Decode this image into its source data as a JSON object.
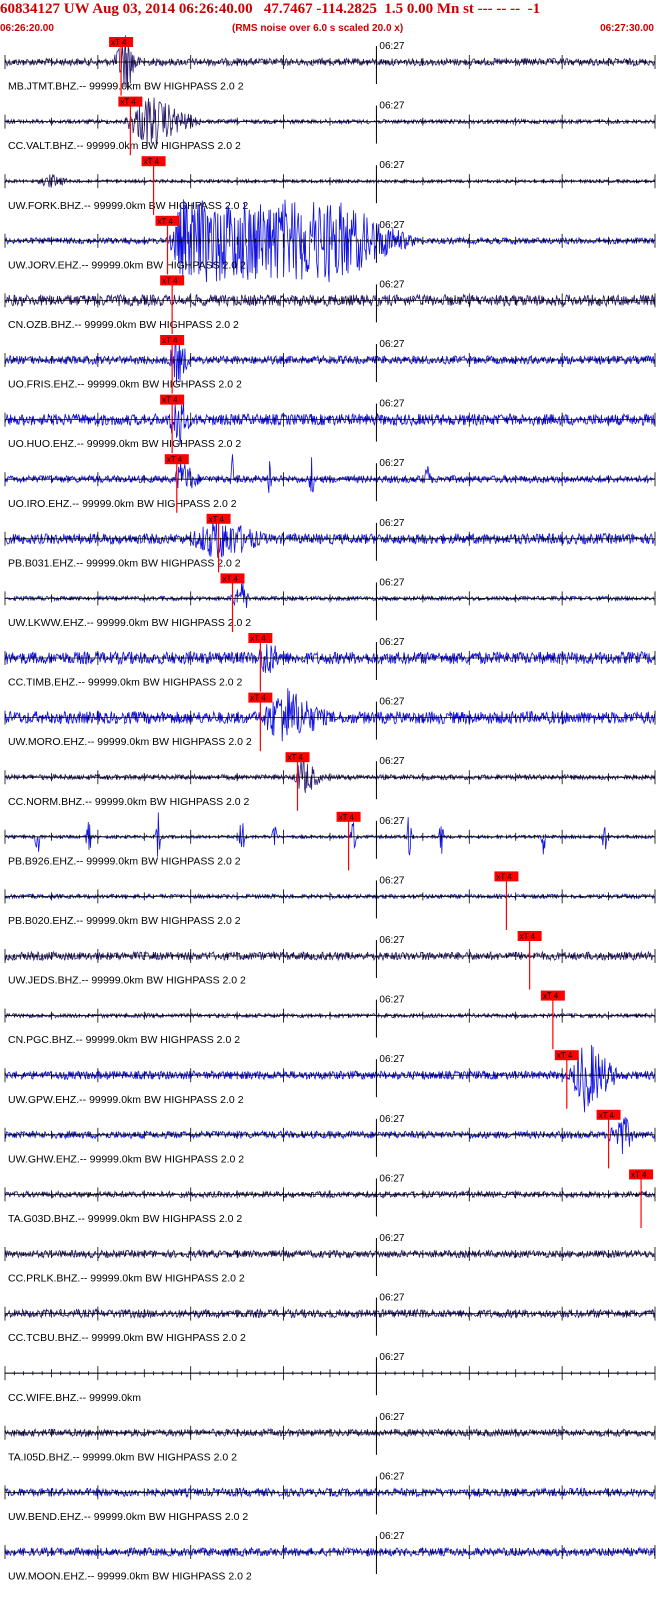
{
  "header": {
    "title": "60834127 UW Aug 03, 2014 06:26:40.00   47.7467 -114.2825  1.5 0.00 Mn st --- -- --  -1",
    "start_time": "06:26:20.00",
    "rms_note": "(RMS noise over 6.0 s scaled 20.0 x)",
    "end_time": "06:27:30.00"
  },
  "colors": {
    "header_text": "#cc0000",
    "trace_dark": "#2a1a6e",
    "trace_blue": "#1010e0",
    "pick": "#ff0000",
    "axis": "#000000"
  },
  "chart_data": {
    "type": "line",
    "title": "60834127 UW Aug 03, 2014 06:26:40.00   47.7467 -114.2825  1.5 0.00 Mn st --- -- --  -1",
    "x_axis": {
      "start": "06:26:20.00",
      "end": "06:27:30.00",
      "tick_label": "06:27"
    },
    "pick_label": "xT 4",
    "traces": [
      {
        "label": "MB.JTMT.BHZ.-- 99999.0km BW  HIGHPASS  2.0  2",
        "color": "dark",
        "pick_s": 12.5,
        "noise": 0.14,
        "burst": {
          "start": 11.5,
          "peak": 13.0,
          "dur": 3.5,
          "amp": 1.3
        }
      },
      {
        "label": "CC.VALT.BHZ.-- 99999.0km BW  HIGHPASS  2.0  2",
        "color": "dark",
        "pick_s": 13.5,
        "noise": 0.08,
        "burst": {
          "start": 12.5,
          "peak": 15.5,
          "dur": 10,
          "amp": 1.1
        }
      },
      {
        "label": "UW.FORK.BHZ.-- 99999.0km BW  HIGHPASS  2.0  2",
        "color": "dark",
        "pick_s": 16.0,
        "noise": 0.06,
        "burst": {
          "start": 3,
          "peak": 5,
          "dur": 5,
          "amp": 0.3
        }
      },
      {
        "label": "UW.JORV.EHZ.-- 99999.0km BW  HIGHPASS  2.0  2",
        "color": "blue",
        "pick_s": 17.5,
        "noise": 0.12,
        "burst": {
          "start": 17.5,
          "peak": 19.0,
          "dur": 29,
          "amp": 1.6,
          "plateau": 17
        }
      },
      {
        "label": "CN.OZB.BHZ.-- 99999.0km BW  HIGHPASS  2.0  2",
        "color": "dark",
        "pick_s": 18.0,
        "noise": 0.22,
        "burst": null
      },
      {
        "label": "UO.FRIS.EHZ.-- 99999.0km BW  HIGHPASS  2.0  2",
        "color": "blue",
        "pick_s": 18.0,
        "noise": 0.16,
        "burst": {
          "start": 17.5,
          "peak": 18.5,
          "dur": 3,
          "amp": 1.1
        }
      },
      {
        "label": "UO.HUO.EHZ.-- 99999.0km BW  HIGHPASS  2.0  2",
        "color": "blue",
        "pick_s": 18.0,
        "noise": 0.22,
        "burst": {
          "start": 17.5,
          "peak": 18.5,
          "dur": 3,
          "amp": 1.4
        }
      },
      {
        "label": "UO.IRO.EHZ.-- 99999.0km BW  HIGHPASS  2.0  2",
        "color": "blue",
        "pick_s": 18.5,
        "noise": 0.14,
        "burst": {
          "start": 18.0,
          "peak": 19.0,
          "dur": 4,
          "amp": 0.8
        },
        "spikes": [
          24.5,
          28.5,
          33.0,
          45.5
        ]
      },
      {
        "label": "PB.B031.EHZ.-- 99999.0km BW  HIGHPASS  2.0  2",
        "color": "blue",
        "pick_s": 23.0,
        "noise": 0.2,
        "burst": {
          "start": 19.0,
          "peak": 23.0,
          "dur": 12,
          "amp": 0.9
        }
      },
      {
        "label": "UW.LKWW.EHZ.-- 99999.0km BW  HIGHPASS  2.0  2",
        "color": "blue",
        "pick_s": 24.5,
        "noise": 0.08,
        "burst": {
          "start": 24.0,
          "peak": 25.5,
          "dur": 3,
          "amp": 0.7
        }
      },
      {
        "label": "CC.TIMB.EHZ.-- 99999.0km BW  HIGHPASS  2.0  2",
        "color": "blue",
        "pick_s": 27.5,
        "noise": 0.24,
        "burst": {
          "start": 27.0,
          "peak": 28.0,
          "dur": 4,
          "amp": 0.9
        }
      },
      {
        "label": "UW.MORO.EHZ.-- 99999.0km BW  HIGHPASS  2.0  2",
        "color": "blue",
        "pick_s": 27.5,
        "noise": 0.24,
        "burst": {
          "start": 27.0,
          "peak": 30.0,
          "dur": 10,
          "amp": 1.3
        }
      },
      {
        "label": "CC.NORM.BHZ.-- 99999.0km BW  HIGHPASS  2.0  2",
        "color": "dark",
        "pick_s": 31.5,
        "noise": 0.1,
        "burst": {
          "start": 31.0,
          "peak": 32.0,
          "dur": 4,
          "amp": 0.9
        }
      },
      {
        "label": "PB.B926.EHZ.-- 99999.0km BW  HIGHPASS  2.0  2",
        "color": "blue",
        "pick_s": 37.0,
        "noise": 0.06,
        "burst": null,
        "spikes": [
          3.5,
          9.0,
          16.5,
          25.5,
          29.0,
          37.5,
          43.5,
          47.0,
          58.0,
          64.5
        ]
      },
      {
        "label": "PB.B020.EHZ.-- 99999.0km BW  HIGHPASS  2.0  2",
        "color": "blue",
        "pick_s": 54.0,
        "noise": 0.08,
        "burst": null
      },
      {
        "label": "UW.JEDS.BHZ.-- 99999.0km BW  HIGHPASS  2.0  2",
        "color": "dark",
        "pick_s": 56.5,
        "noise": 0.16,
        "burst": null
      },
      {
        "label": "CN.PGC.BHZ.-- 99999.0km BW  HIGHPASS  2.0  2",
        "color": "dark",
        "pick_s": 59.0,
        "noise": 0.08,
        "burst": null
      },
      {
        "label": "UW.GPW.EHZ.-- 99999.0km BW  HIGHPASS  2.0  2",
        "color": "blue",
        "pick_s": 60.5,
        "noise": 0.16,
        "burst": {
          "start": 60.5,
          "peak": 62.5,
          "dur": 7,
          "amp": 1.5
        }
      },
      {
        "label": "UW.GHW.EHZ.-- 99999.0km BW  HIGHPASS  2.0  2",
        "color": "blue",
        "pick_s": 65.0,
        "noise": 0.14,
        "burst": {
          "start": 64.5,
          "peak": 66.5,
          "dur": 4,
          "amp": 0.9
        }
      },
      {
        "label": "TA.G03D.BHZ.-- 99999.0km BW  HIGHPASS  2.0  2",
        "color": "dark",
        "pick_s": 68.5,
        "noise": 0.12,
        "burst": null
      },
      {
        "label": "CC.PRLK.BHZ.-- 99999.0km BW  HIGHPASS  2.0  2",
        "color": "dark",
        "pick_s": null,
        "noise": 0.14,
        "burst": null
      },
      {
        "label": "CC.TCBU.BHZ.-- 99999.0km BW  HIGHPASS  2.0  2",
        "color": "dark",
        "pick_s": null,
        "noise": 0.16,
        "burst": null
      },
      {
        "label": "CC.WIFE.BHZ.-- 99999.0km",
        "color": "dark",
        "pick_s": null,
        "noise": 0.0,
        "burst": null
      },
      {
        "label": "TA.I05D.BHZ.-- 99999.0km BW  HIGHPASS  2.0  2",
        "color": "dark",
        "pick_s": null,
        "noise": 0.14,
        "burst": null
      },
      {
        "label": "UW.BEND.EHZ.-- 99999.0km BW  HIGHPASS  2.0  2",
        "color": "blue",
        "pick_s": null,
        "noise": 0.16,
        "burst": null
      },
      {
        "label": "UW.MOON.EHZ.-- 99999.0km BW  HIGHPASS  2.0  2",
        "color": "blue",
        "pick_s": null,
        "noise": 0.16,
        "burst": null
      }
    ]
  }
}
